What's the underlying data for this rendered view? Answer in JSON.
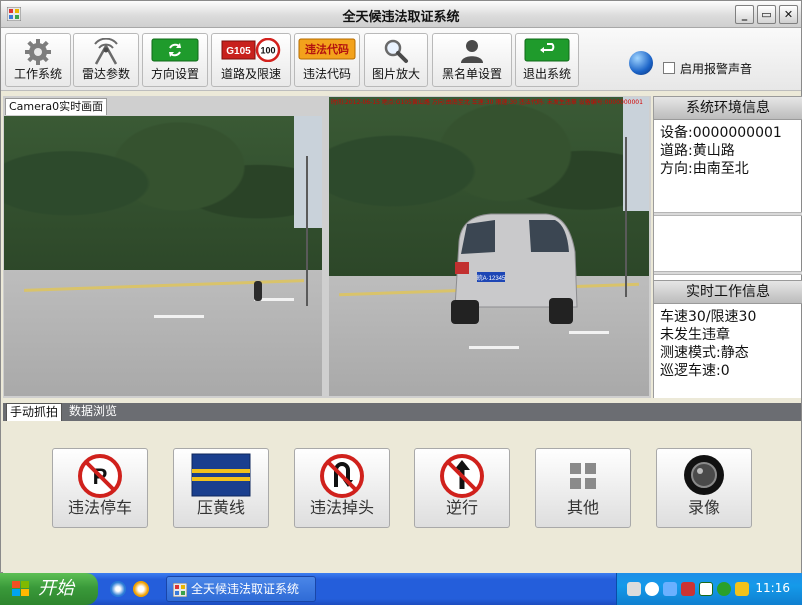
{
  "window": {
    "title": "全天候违法取证系统",
    "controls": {
      "minimize": "_",
      "maximize": "▭",
      "close": "✕"
    }
  },
  "toolbar": {
    "buttons": [
      {
        "label": "工作系统",
        "icon": "gear-icon"
      },
      {
        "label": "雷达参数",
        "icon": "radar-icon"
      },
      {
        "label": "方向设置",
        "icon": "direction-icon"
      },
      {
        "label": "道路及限速",
        "icon": "road-speed-sign-icon",
        "sign_road": "G105",
        "sign_speed": "100"
      },
      {
        "label": "违法代码",
        "icon": "violation-code-icon",
        "sign_text": "违法代码"
      },
      {
        "label": "图片放大",
        "icon": "magnifier-icon"
      },
      {
        "label": "黑名单设置",
        "icon": "user-icon"
      },
      {
        "label": "退出系统",
        "icon": "exit-icon"
      }
    ],
    "alarm_checkbox": {
      "label": "启用报警声音",
      "checked": false
    }
  },
  "video": {
    "camera_tab": "Camera0实时画面",
    "overlay_text": "时间:2012-06-15 地点:G105黄山路 方向:由南至北 车速:30 限速:30 违法代码: 未发生违章 设备编号:0000000001",
    "plate": "皖A·12345"
  },
  "side_panel": {
    "env_title": "系统环境信息",
    "env_lines": [
      "设备:0000000001",
      "道路:黄山路",
      "方向:由南至北"
    ],
    "work_title": "实时工作信息",
    "work_lines": [
      "车速30/限速30",
      "未发生违章",
      "测速模式:静态",
      "巡逻车速:0"
    ]
  },
  "tabs": [
    {
      "label": "手动抓拍",
      "active": true
    },
    {
      "label": "数据浏览",
      "active": false
    }
  ],
  "actions": [
    {
      "label": "违法停车",
      "icon": "no-parking-icon"
    },
    {
      "label": "压黄线",
      "icon": "yellow-line-icon"
    },
    {
      "label": "违法掉头",
      "icon": "no-u-turn-icon"
    },
    {
      "label": "逆行",
      "icon": "wrong-way-icon"
    },
    {
      "label": "其他",
      "icon": "grid-icon"
    },
    {
      "label": "录像",
      "icon": "record-icon"
    }
  ],
  "taskbar": {
    "start_label": "开始",
    "task_label": "全天候违法取证系统",
    "clock": "11:16"
  }
}
